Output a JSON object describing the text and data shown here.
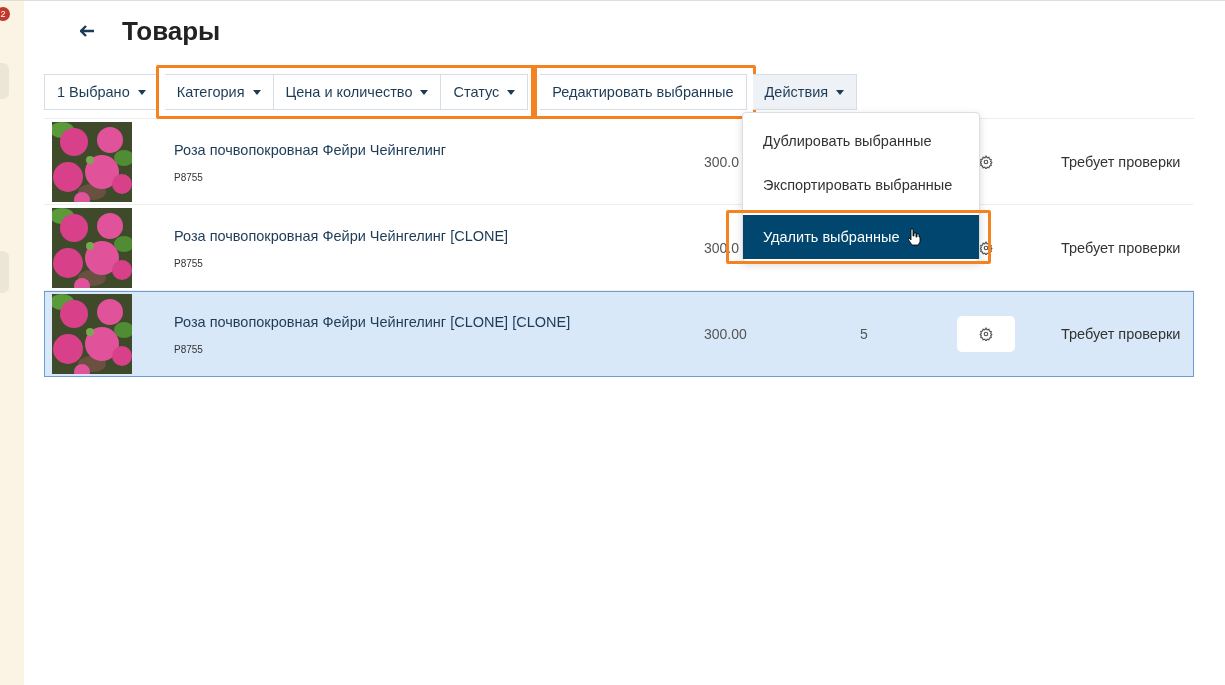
{
  "sidebar": {
    "badge": "2"
  },
  "header": {
    "title": "Товары"
  },
  "toolbar": {
    "groups": [
      {
        "highlighted": false,
        "buttons": [
          {
            "label": "1 Выбрано",
            "caret": true
          }
        ]
      },
      {
        "highlighted": true,
        "buttons": [
          {
            "label": "Категория",
            "caret": true
          },
          {
            "label": "Цена и количество",
            "caret": true
          },
          {
            "label": "Статус",
            "caret": true
          }
        ]
      },
      {
        "highlighted": true,
        "buttons": [
          {
            "label": "Редактировать выбранные",
            "caret": false
          }
        ]
      },
      {
        "highlighted": false,
        "buttons": [
          {
            "label": "Действия",
            "caret": true
          }
        ]
      }
    ]
  },
  "actions_menu": {
    "items": [
      {
        "label": "Дублировать выбранные",
        "selected": false,
        "highlighted": false
      },
      {
        "label": "Экспортировать выбранные",
        "selected": false,
        "highlighted": false
      },
      {
        "label": "Удалить выбранные",
        "selected": true,
        "highlighted": true
      }
    ]
  },
  "table": {
    "rows": [
      {
        "name": "Роза почвопокровная Фейри Чейнгелинг",
        "sku": "P8755",
        "price": "300.0",
        "status": "Требует проверки",
        "selected": false
      },
      {
        "name": "Роза почвопокровная Фейри Чейнгелинг [CLONE]",
        "sku": "P8755",
        "price": "300.0",
        "status": "Требует проверки",
        "selected": false
      },
      {
        "name": "Роза почвопокровная Фейри Чейнгелинг [CLONE] [CLONE]",
        "sku": "P8755",
        "price": "300.00",
        "quantity": "5",
        "status": "Требует проверки",
        "selected": true
      }
    ]
  }
}
